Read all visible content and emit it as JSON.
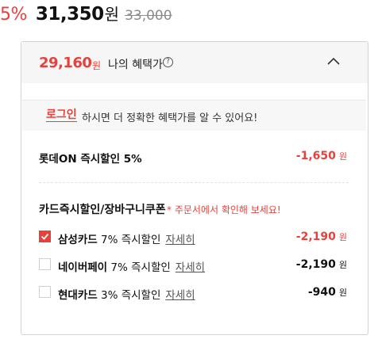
{
  "price": {
    "discount_rate": "5%",
    "final_price": "31,350",
    "final_unit": "원",
    "original_price": "33,000"
  },
  "benefit_panel": {
    "best_price": "29,160",
    "best_price_unit": "원",
    "label": "나의 혜택가",
    "help_icon": "?",
    "toggle_icon": "chevron-up-icon",
    "login_link": "로그인",
    "login_message": "하시면 더 정확한 혜택가를 알 수 있어요!",
    "instant_discount": {
      "label": "롯데ON 즉시할인 5%",
      "amount": "-1,650",
      "unit": "원"
    },
    "card_section": {
      "title": "카드즉시할인/장바구니쿠폰",
      "note": "* 주문서에서 확인해 보세요!",
      "items": [
        {
          "name": "삼성카드",
          "rate": "7% 즉시할인",
          "detail": "자세히",
          "amount": "-2,190",
          "unit": "원",
          "checked": true
        },
        {
          "name": "네이버페이",
          "rate": "7% 즉시할인",
          "detail": "자세히",
          "amount": "-2,190",
          "unit": "원",
          "checked": false
        },
        {
          "name": "현대카드",
          "rate": "3% 즉시할인",
          "detail": "자세히",
          "amount": "-940",
          "unit": "원",
          "checked": false
        }
      ]
    }
  },
  "colors": {
    "accent": "#e8403a",
    "panel_header_bg": "#f6f6f6",
    "border": "#d3d3d3"
  }
}
